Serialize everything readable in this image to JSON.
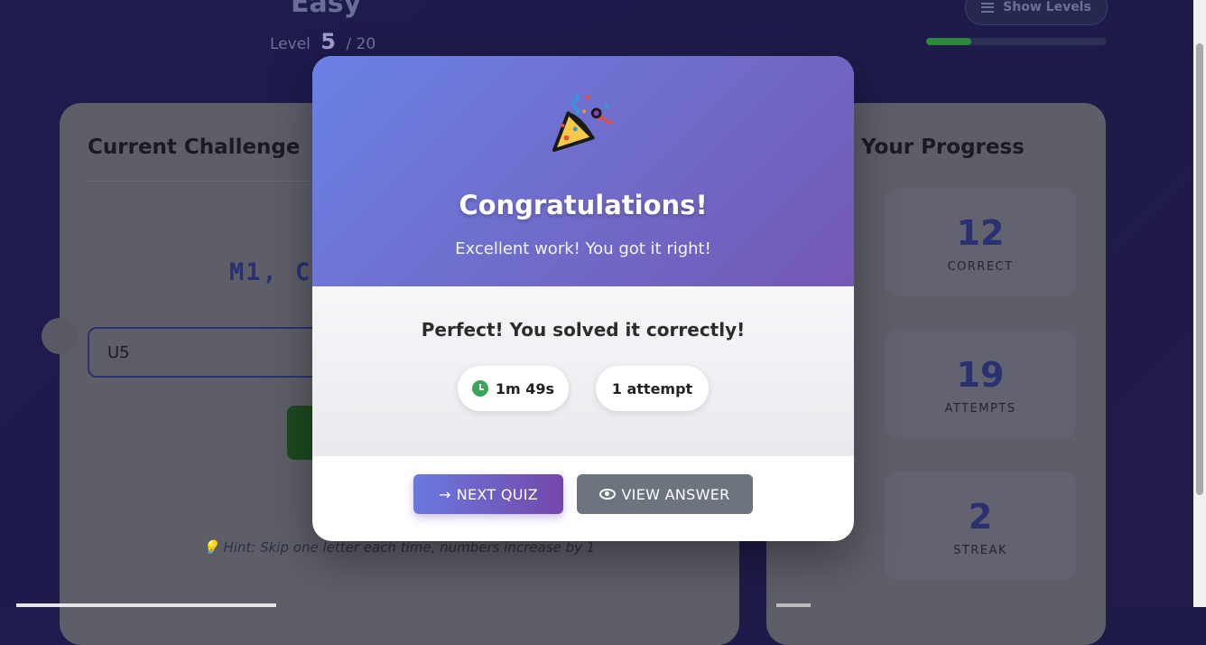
{
  "header": {
    "difficulty": "Easy",
    "level_label": "Level",
    "level_current": "5",
    "level_total": "/ 20",
    "show_levels_label": "Show Levels",
    "progress_fraction": 0.25,
    "progress_color": "#2e8a3a"
  },
  "challenge": {
    "title": "Current Challenge",
    "sequence_visible": "M1, C",
    "input_value": "U5",
    "hint": "💡 Hint: Skip one letter each time, numbers increase by 1"
  },
  "progress": {
    "title": "Your Progress",
    "stats": [
      {
        "value": "12",
        "label": "CORRECT"
      },
      {
        "value": "19",
        "label": "ATTEMPTS"
      },
      {
        "value": "2",
        "label": "STREAK"
      }
    ]
  },
  "modal": {
    "icon": "party-popper-icon",
    "title": "Congratulations!",
    "subtitle": "Excellent work! You got it right!",
    "message": "Perfect! You solved it correctly!",
    "time": "1m 49s",
    "attempts": "1 attempt",
    "next_label": "NEXT QUIZ",
    "view_label": "VIEW ANSWER",
    "colors": {
      "header_start": "#6a82e4",
      "header_end": "#7458b4",
      "view_button": "#6c757d",
      "clock": "#3aa55a"
    }
  }
}
